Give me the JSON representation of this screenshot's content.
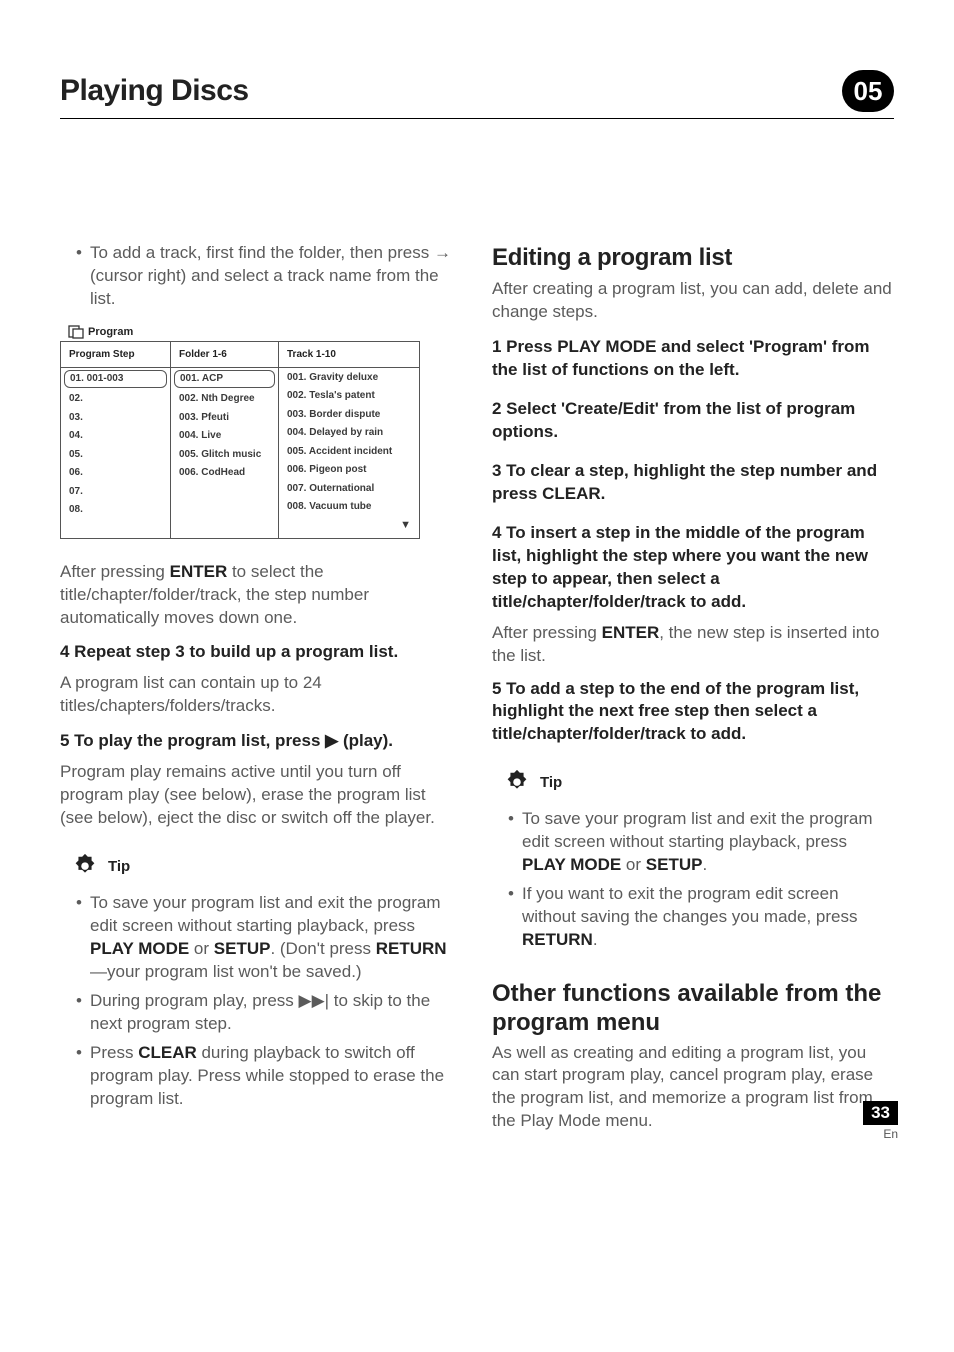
{
  "header": {
    "section_title": "Playing Discs",
    "chapter_number": "05"
  },
  "left": {
    "bullet1_pre": "To add a track, first find the folder, then press ",
    "bullet1_glyph": "→",
    "bullet1_post": " (cursor right) and select a track name from the list.",
    "program_box": {
      "title": "Program",
      "headers": [
        "Program Step",
        "Folder 1-6",
        "Track 1-10"
      ],
      "steps": [
        "01. 001-003",
        "02.",
        "03.",
        "04.",
        "05.",
        "06.",
        "07.",
        "08."
      ],
      "folders": [
        "001. ACP",
        "002. Nth Degree",
        "003. Pfeuti",
        "004. Live",
        "005. Glitch music",
        "006. CodHead"
      ],
      "tracks": [
        "001. Gravity deluxe",
        "002. Tesla's patent",
        "003. Border dispute",
        "004. Delayed by rain",
        "005. Accident incident",
        "006. Pigeon post",
        "007. Outernational",
        "008. Vacuum tube"
      ]
    },
    "after_enter_pre": "After pressing ",
    "after_enter_bold": "ENTER",
    "after_enter_post": " to select the title/chapter/folder/track, the step number automatically moves down one.",
    "step4_head": "4   Repeat step 3 to build up a program list.",
    "step4_body": "A program list can contain up to 24 titles/chapters/folders/tracks.",
    "step5_head_pre": "5   To play the program list, press ",
    "step5_head_glyph": "▶",
    "step5_head_post": " (play).",
    "step5_body": "Program play remains active until you turn off program play (see below), erase the program list (see below), eject the disc or switch off the player.",
    "tip_label": "Tip",
    "tip1_pre": "To save your program list and exit the program edit screen without starting playback, press ",
    "tip1_b1": "PLAY MODE",
    "tip1_mid": " or ",
    "tip1_b2": "SETUP",
    "tip1_after": ". (Don't press ",
    "tip1_b3": "RETURN",
    "tip1_end": "—your program list won't be saved.)",
    "tip2_pre": "During program play, press ",
    "tip2_glyph": "▶▶|",
    "tip2_post": " to skip to the next program step.",
    "tip3_pre": "Press ",
    "tip3_b1": "CLEAR",
    "tip3_post": " during playback to switch off program play. Press while stopped to erase the program list."
  },
  "right": {
    "h1": "Editing a program list",
    "intro": "After creating a program list, you can add, delete and change steps.",
    "s1": "1   Press PLAY MODE and select 'Program' from the list of functions on the left.",
    "s2": "2   Select 'Create/Edit' from the list of program options.",
    "s3": "3   To clear a step, highlight the step number and press CLEAR.",
    "s4": "4   To insert a step in the middle of the program list, highlight the step where you want the new step to appear, then select a title/chapter/folder/track to add.",
    "s4_body_pre": "After pressing ",
    "s4_body_b": "ENTER",
    "s4_body_post": ", the new step is inserted into the list.",
    "s5": "5   To add a step to the end of the program list, highlight the next free step then select a title/chapter/folder/track to add.",
    "tip_label": "Tip",
    "tip1_pre": "To save your program list and exit the program edit screen without starting playback, press ",
    "tip1_b1": "PLAY MODE",
    "tip1_mid": " or ",
    "tip1_b2": "SETUP",
    "tip1_end": ".",
    "tip2_pre": "If you want to exit the program edit screen without saving the changes you made, press ",
    "tip2_b1": "RETURN",
    "tip2_end": ".",
    "h2": "Other functions available from the program menu",
    "h2_body": "As well as creating and editing a program list, you can start program play, cancel program play, erase the program list, and memorize a program list from the Play Mode menu."
  },
  "footer": {
    "page": "33",
    "lang": "En"
  }
}
